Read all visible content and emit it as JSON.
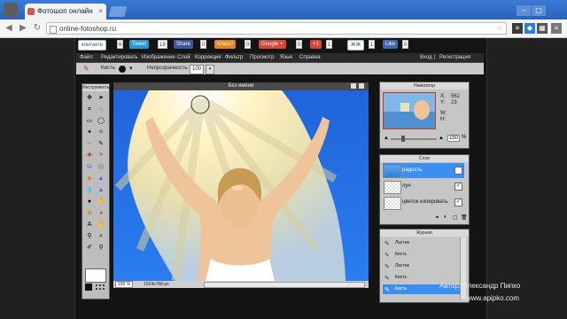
{
  "browser": {
    "tab_title": "Фотошоп онлайн",
    "tab_close": "×",
    "url": "online-fotoshop.ru",
    "nav_back": "◀",
    "nav_forward": "▶",
    "nav_reload": "↻",
    "star": "☆",
    "window_buttons": [
      "–",
      "▢",
      "✕"
    ]
  },
  "social": [
    {
      "label": "контакте",
      "count": "6",
      "color": "#ffffff",
      "text": "#335577"
    },
    {
      "label": "Tweet",
      "count": "19",
      "color": "#2d9ad6",
      "text": "#ffffff"
    },
    {
      "label": "Share",
      "count": "0",
      "color": "#3b5998",
      "text": "#ffffff"
    },
    {
      "label": "Класс!",
      "count": "0",
      "color": "#e8811f",
      "text": "#ffffff"
    },
    {
      "label": "Google +",
      "count": "0",
      "color": "#d34836",
      "text": "#ffffff"
    },
    {
      "label": "+1",
      "count": "1",
      "color": "#d34836",
      "text": "#ffffff"
    },
    {
      "label": "ЖЖ",
      "count": "1",
      "color": "#ffffff",
      "text": "#224466"
    },
    {
      "label": "Like",
      "count": "0",
      "color": "#4267b2",
      "text": "#ffffff"
    }
  ],
  "menu": [
    "Файл",
    "Редактировать",
    "Изображение",
    "Слой",
    "Коррекция",
    "Фильтр",
    "Просмотр",
    "Язык",
    "Справка"
  ],
  "auth": {
    "login": "Вход",
    "sep": "|",
    "register": "Регистрация"
  },
  "options": {
    "brush_label": "Кисть:",
    "opacity_label": "Непрозрачность:",
    "opacity_value": "100"
  },
  "tools_title": "Инструменты",
  "canvas": {
    "title": "Без имени",
    "zoom": "150",
    "zoom_unit": "%",
    "size": "1024x768 px"
  },
  "navigator": {
    "title": "Навигатор",
    "x_label": "X:",
    "x_value": "562",
    "y_label": "Y:",
    "y_value": "23",
    "w_label": "W:",
    "h_label": "H:",
    "zoom": "150",
    "zoom_unit": "%"
  },
  "layers": {
    "title": "Слои",
    "items": [
      {
        "name": "радость",
        "selected": true,
        "checked": "✓"
      },
      {
        "name": "луч",
        "selected": false,
        "checked": "✓"
      },
      {
        "name": "цветок копировать",
        "selected": false,
        "checked": "✓"
      }
    ]
  },
  "history": {
    "title": "Журнал",
    "items": [
      "Ластик",
      "Кисть",
      "Ластик",
      "Кисть",
      "Кисть"
    ]
  },
  "watermark": {
    "author": "Автор: Александр Пипко",
    "site": "www.apipko.com"
  },
  "colors": {
    "accent": "#2b6fd6",
    "selection": "#3399ff"
  }
}
